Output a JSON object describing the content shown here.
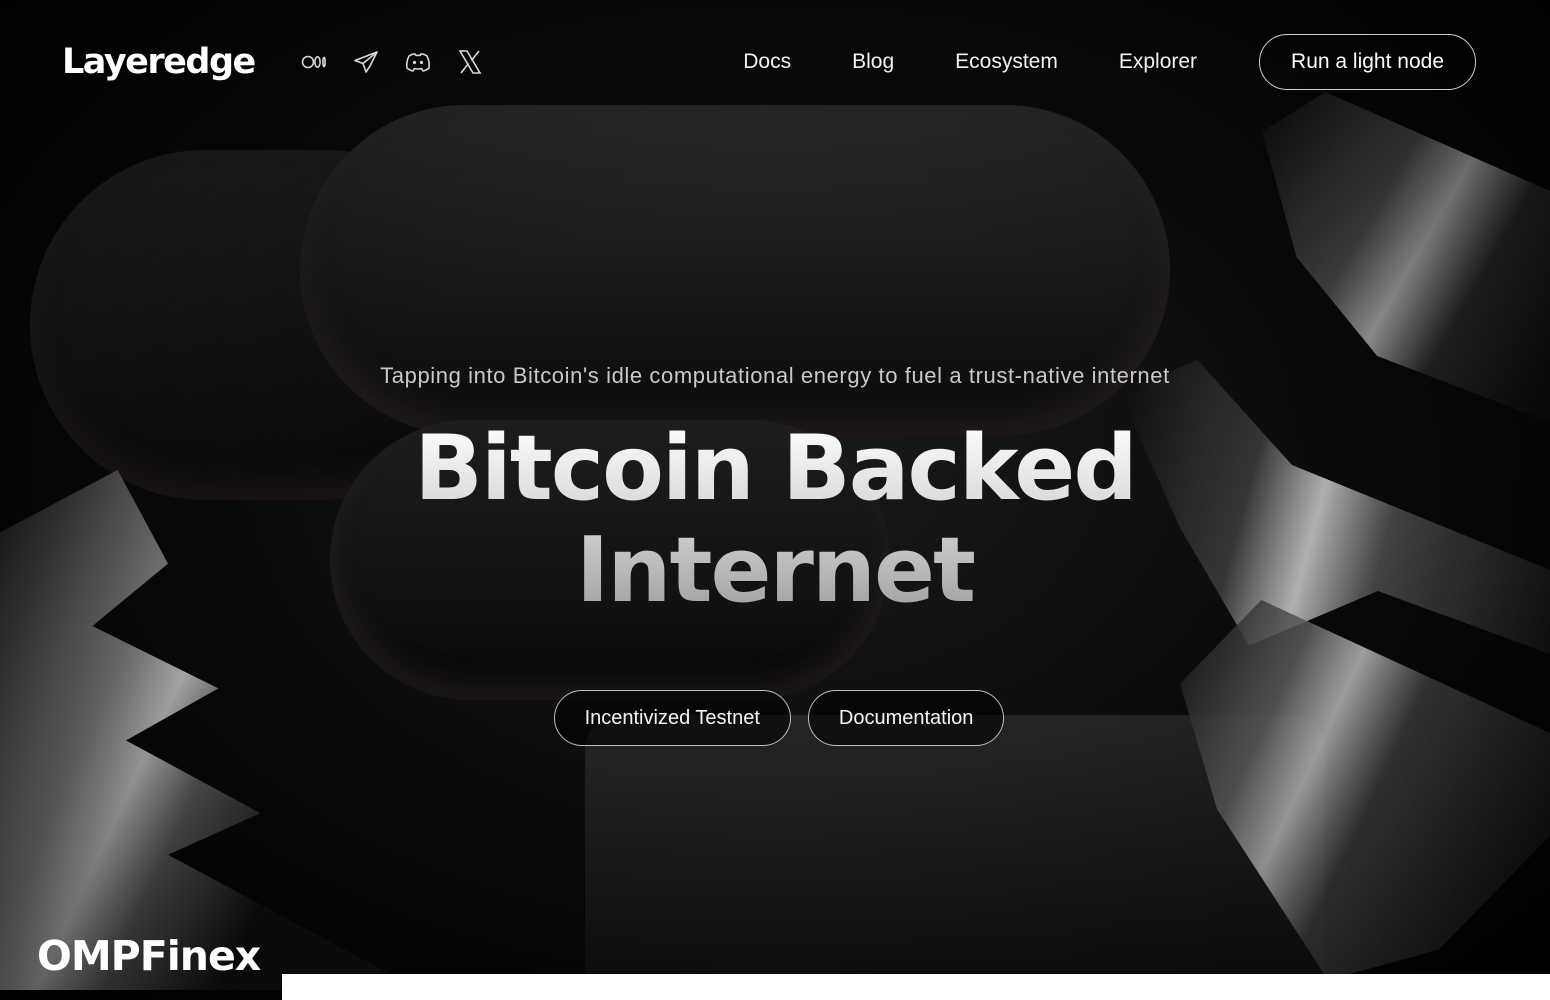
{
  "brand": {
    "logo_text": "Layeredge"
  },
  "socials": [
    {
      "name": "medium-icon"
    },
    {
      "name": "telegram-icon"
    },
    {
      "name": "discord-icon"
    },
    {
      "name": "x-icon"
    }
  ],
  "nav": {
    "items": [
      {
        "label": "Docs"
      },
      {
        "label": "Blog"
      },
      {
        "label": "Ecosystem"
      },
      {
        "label": "Explorer"
      }
    ],
    "cta_label": "Run a light node"
  },
  "hero": {
    "tagline": "Tapping into Bitcoin's idle computational energy to fuel a trust-native internet",
    "headline_line1": "Bitcoin Backed",
    "headline_line2": "Internet",
    "primary_button": "Incentivized Testnet",
    "secondary_button": "Documentation"
  },
  "watermark": {
    "text": "OMPFinex"
  },
  "colors": {
    "background": "#000000",
    "text": "#ffffff",
    "button_border": "#cfcfcf"
  }
}
